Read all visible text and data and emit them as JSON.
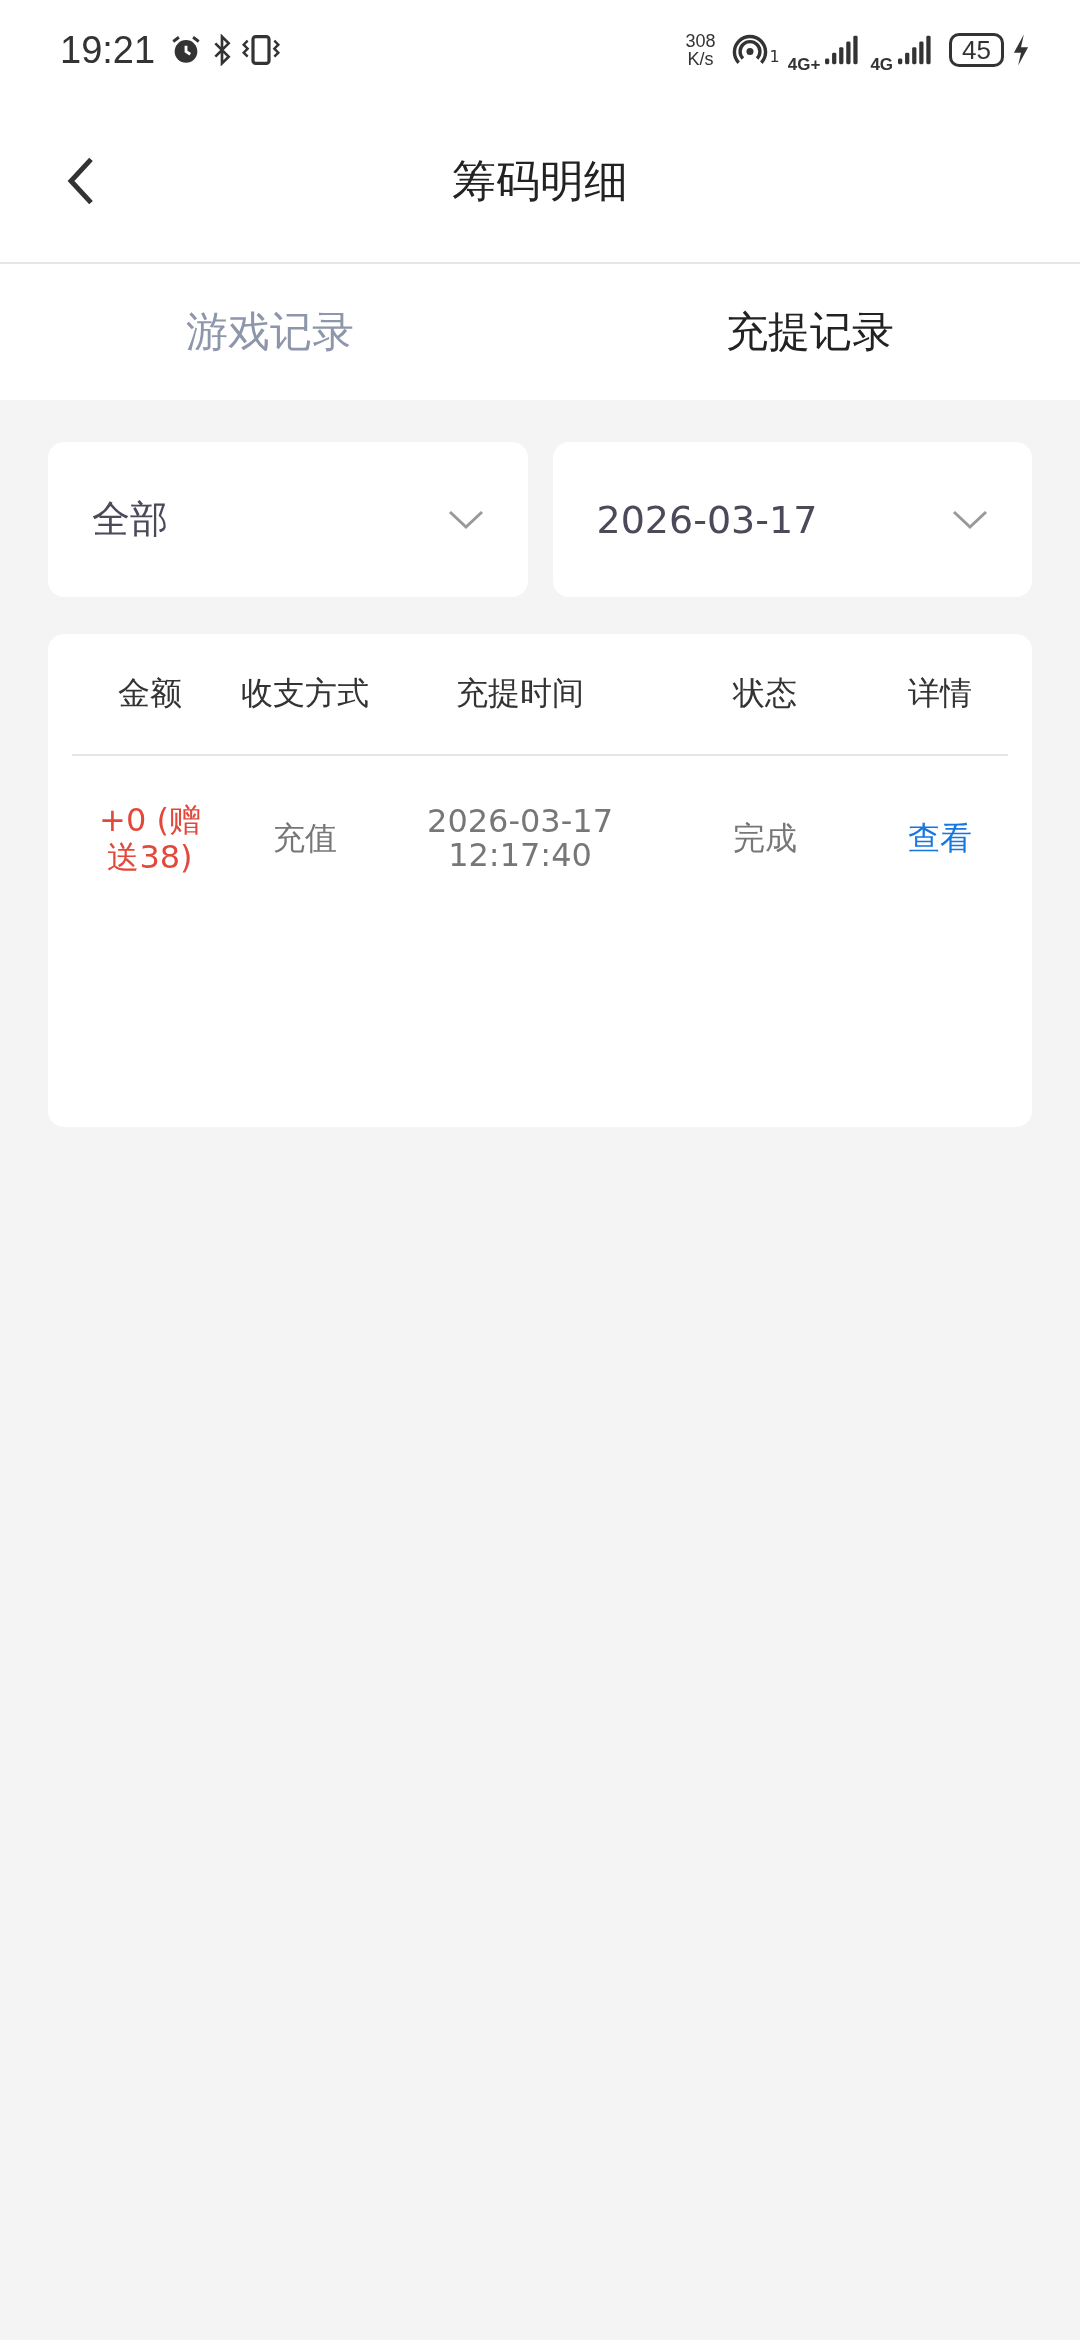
{
  "status_bar": {
    "time": "19:21",
    "net_speed_value": "308",
    "net_speed_unit": "K/s",
    "hotspot_count": "1",
    "sim1_network": "4G+",
    "sim2_network": "4G",
    "battery": "45",
    "charging": true
  },
  "header": {
    "title": "筹码明细"
  },
  "tabs": [
    {
      "label": "游戏记录",
      "selected": false
    },
    {
      "label": "充提记录",
      "selected": true
    }
  ],
  "filters": [
    {
      "value": "全部"
    },
    {
      "value": "2026-03-17"
    }
  ],
  "table": {
    "columns": [
      "金额",
      "收支方式",
      "充提时间",
      "状态",
      "详情"
    ],
    "rows": [
      {
        "amount": "+0 (赠送38)",
        "method": "充值",
        "time": "2026-03-17 12:17:40",
        "status": "完成",
        "detail": "查看"
      }
    ]
  }
}
